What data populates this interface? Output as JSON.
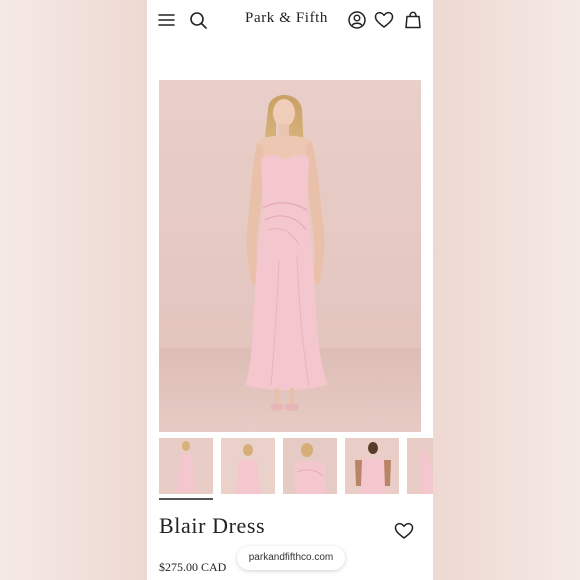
{
  "header": {
    "brand": "Park & Fifth",
    "icons": [
      "menu-icon",
      "search-icon",
      "account-icon",
      "heart-icon",
      "bag-icon"
    ]
  },
  "product": {
    "title": "Blair Dress",
    "price": "$275.00 CAD",
    "selected_thumbnail": 1,
    "thumbnail_count": 5,
    "dress_color": "#f4c6ce"
  },
  "browser": {
    "url": "parkandfifthco.com"
  }
}
